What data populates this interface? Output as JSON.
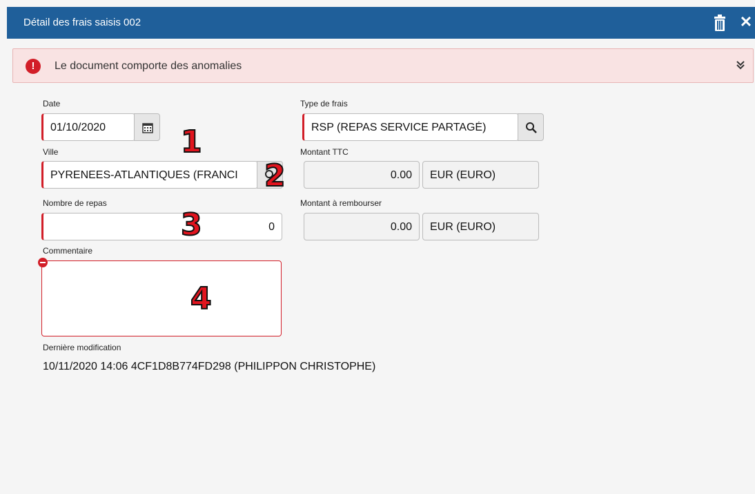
{
  "window": {
    "title": "Détail des frais saisis 002",
    "delete_icon": "trash-icon",
    "close_icon": "close-icon",
    "accent": "#1f5f9a"
  },
  "alert": {
    "message": "Le document comporte des anomalies",
    "icon": "exclamation-circle-icon",
    "toggle_icon": "double-chevron-down-icon"
  },
  "form": {
    "date": {
      "label": "Date",
      "value": "01/10/2020",
      "icon": "calendar-icon"
    },
    "type_frais": {
      "label": "Type de frais",
      "value": "RSP (REPAS SERVICE PARTAGÉ)",
      "icon": "search-icon"
    },
    "ville": {
      "label": "Ville",
      "value": "PYRENEES-ATLANTIQUES (FRANCI",
      "icon": "search-icon"
    },
    "montant_ttc": {
      "label": "Montant TTC",
      "amount": "0.00",
      "currency": "EUR (EURO)"
    },
    "nombre_repas": {
      "label": "Nombre de repas",
      "value": "0"
    },
    "montant_rembourser": {
      "label": "Montant à rembourser",
      "amount": "0.00",
      "currency": "EUR (EURO)"
    },
    "commentaire": {
      "label": "Commentaire",
      "value": ""
    },
    "derniere_modification": {
      "label": "Dernière modification",
      "value": "10/11/2020 14:06 4CF1D8B774FD298 (PHILIPPON CHRISTOPHE)"
    }
  },
  "annotations": [
    "1",
    "2",
    "3",
    "4"
  ],
  "colors": {
    "required": "#d21e28",
    "annotation": "#e1141e"
  }
}
